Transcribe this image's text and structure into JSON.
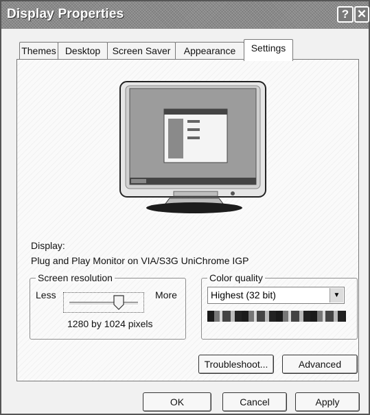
{
  "window": {
    "title": "Display Properties",
    "help_label": "?",
    "close_label": "✕"
  },
  "tabs": [
    {
      "label": "Themes"
    },
    {
      "label": "Desktop"
    },
    {
      "label": "Screen Saver"
    },
    {
      "label": "Appearance"
    },
    {
      "label": "Settings",
      "active": true
    }
  ],
  "display": {
    "label": "Display:",
    "device": "Plug and Play Monitor on VIA/S3G UniChrome IGP"
  },
  "resolution": {
    "group_label": "Screen resolution",
    "less_label": "Less",
    "more_label": "More",
    "value_text": "1280 by 1024 pixels",
    "slider_fraction": 0.72
  },
  "color_quality": {
    "group_label": "Color quality",
    "selected": "Highest (32 bit)"
  },
  "buttons": {
    "troubleshoot": "Troubleshoot...",
    "advanced": "Advanced",
    "ok": "OK",
    "cancel": "Cancel",
    "apply": "Apply"
  }
}
